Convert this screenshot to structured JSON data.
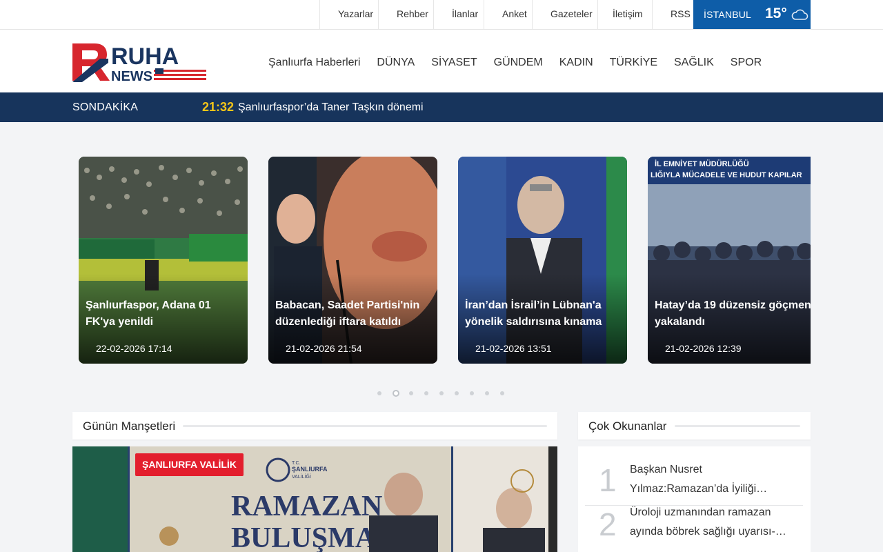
{
  "topbar": {
    "links": [
      "Yazarlar",
      "Rehber",
      "İlanlar",
      "Anket",
      "Gazeteler",
      "İletişim",
      "RSS"
    ],
    "weather": {
      "city": "İSTANBUL",
      "temp": "15°",
      "icon": "cloud-icon"
    }
  },
  "logo": {
    "text_main": "RUHA",
    "text_sub": "NEWS",
    "letter": "R",
    "colors": {
      "red": "#d7262e",
      "navy": "#1a3560"
    }
  },
  "nav": [
    "Şanlıurfa Haberleri",
    "DÜNYA",
    "SİYASET",
    "GÜNDEM",
    "KADIN",
    "TÜRKİYE",
    "SAĞLIK",
    "SPOR"
  ],
  "breaking": {
    "label": "SONDAKİKA",
    "time": "21:32",
    "headline": "Şanlıurfaspor’da Taner Taşkın dönemi"
  },
  "slider": {
    "cards": [
      {
        "title": "Şanlıurfaspor, Adana 01 FK'ya yenildi",
        "date": "22-02-2026 17:14",
        "image": "stadium-football-photo"
      },
      {
        "title": "Babacan, Saadet Partisi'nin düzenlediği iftara katıldı",
        "date": "21-02-2026 21:54",
        "image": "politician-speech-photo"
      },
      {
        "title": "İran’dan İsrail’in Lübnan'a yönelik saldırısına kınama",
        "date": "21-02-2026 13:51",
        "image": "spokesman-podium-photo"
      },
      {
        "title": "Hatay’da 19 düzensiz göçmen yakalandı",
        "date": "21-02-2026 12:39",
        "image": "migrants-group-photo"
      }
    ],
    "dots_count": 9,
    "active_dot": 1
  },
  "sections": {
    "headlines_title": "Günün Manşetleri",
    "mostread_title": "Çok Okunanlar"
  },
  "manset": {
    "tag": "ŞANLIURFA VALİLİK",
    "image": "ramazan-bulusmasi-photo",
    "banner_text": "RAMAZAN BULUŞMA",
    "logo_text": [
      "T.C.",
      "ŞANLIURFA",
      "VALİLİĞİ"
    ]
  },
  "mostread": [
    {
      "num": "1",
      "text": "Başkan Nusret Yılmaz:Ramazan’da İyiliği…"
    },
    {
      "num": "2",
      "text": "Üroloji uzmanından ramazan ayında böbrek sağlığı uyarısı-…"
    }
  ],
  "slide_images": {
    "card2_sign": "",
    "card4_sign": "İL EMNİYET MÜDÜRLÜĞÜ LIĞIYLA MÜCADELE VE HUDUT KAPILAR"
  }
}
